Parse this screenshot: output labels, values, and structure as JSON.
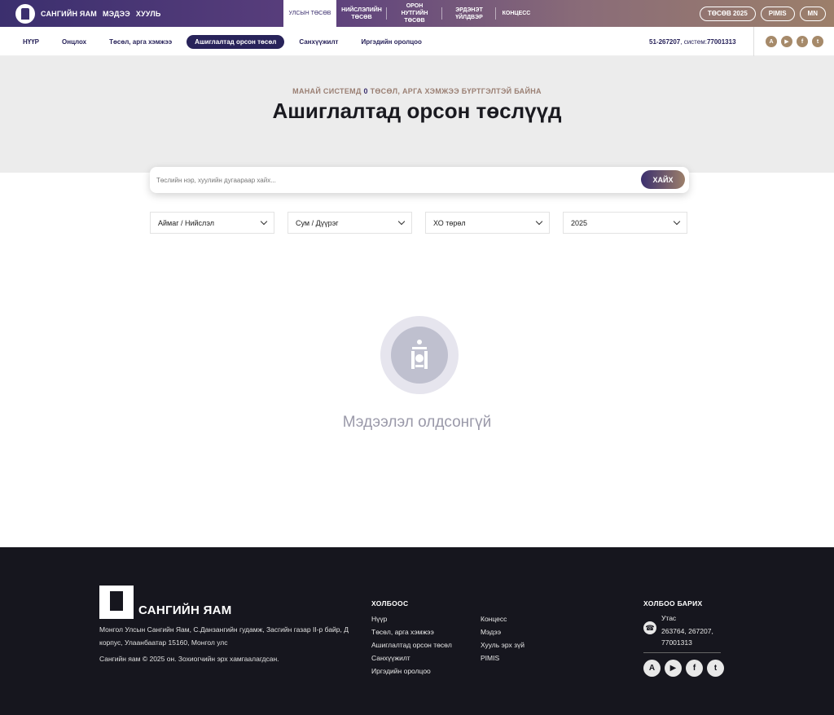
{
  "header": {
    "brand_links": [
      "САНГИЙН ЯАМ",
      "МЭДЭЭ",
      "ХУУЛЬ"
    ],
    "tabs": [
      {
        "line1": "УЛСЫН ТӨСӨВ",
        "line2": "",
        "line3": ""
      },
      {
        "line1": "НИЙСЛЭЛИЙН",
        "line2": "ТӨСӨВ",
        "line3": ""
      },
      {
        "line1": "ОРОН",
        "line2": "НУТГИЙН",
        "line3": "ТӨСӨВ"
      },
      {
        "line1": "ЭРДЭНЭТ",
        "line2": "ҮЙЛДВЭР",
        "line3": ""
      },
      {
        "line1": "КОНЦЕСС",
        "line2": "",
        "line3": ""
      }
    ],
    "pills": [
      "ТӨСӨВ 2025",
      "PIMIS",
      "MN"
    ]
  },
  "subnav": {
    "items": [
      "НҮҮР",
      "Онцлох",
      "Төсөл, арга хэмжээ",
      "Ашиглалтад орсон төсөл",
      "Санхүүжилт",
      "Иргэдийн оролцоо"
    ],
    "contact_number": "51-267207",
    "contact_system_label": ", систем: ",
    "contact_system_number": "77001313",
    "social_icons": [
      "appstore-icon",
      "googleplay-icon",
      "facebook-icon",
      "twitter-icon"
    ]
  },
  "hero": {
    "subtitle_prefix": "МАНАЙ СИСТЕМД ",
    "subtitle_count": "0",
    "subtitle_suffix": " ТӨСӨЛ, АРГА ХЭМЖЭЭ БҮРТГЭЛТЭЙ БАЙНА",
    "title": "Ашиглалтад орсон төслүүд"
  },
  "search": {
    "placeholder": "Төслийн нэр, хуулийн дугаараар хайх...",
    "button_label": "ХАЙХ"
  },
  "filters": [
    {
      "name": "province",
      "selected": "Аймаг / Нийслэл"
    },
    {
      "name": "district",
      "selected": "Сум / Дүүрэг"
    },
    {
      "name": "type",
      "selected": "ХО төрөл"
    },
    {
      "name": "year",
      "selected": "2025"
    }
  ],
  "empty_state": {
    "message": "Мэдээлэл олдсонгүй"
  },
  "footer": {
    "brand": "САНГИЙН ЯАМ",
    "address": "Монгол Улсын Сангийн Яам, С.Данзангийн гудамж, Засгийн газар II-р байр, Д корпус, Улаанбаатар 15160, Монгол улс",
    "copyright": "Сангийн яам © 2025 он. Зохиогчийн эрх хамгаалагдсан.",
    "links_heading": "ХОЛБООС",
    "links_col1": [
      "Нүүр",
      "Төсөл, арга хэмжээ",
      "Ашиглалтад орсон төсөл",
      "Санхүүжилт",
      "Иргэдийн оролцоо"
    ],
    "links_col2": [
      "Концесс",
      "Мэдээ",
      "Хууль эрх зүй",
      "PIMIS"
    ],
    "contact_heading": "ХОЛБОО БАРИХ",
    "phone_label": "Утас",
    "phone_value": "263764, 267207, 77001313"
  }
}
